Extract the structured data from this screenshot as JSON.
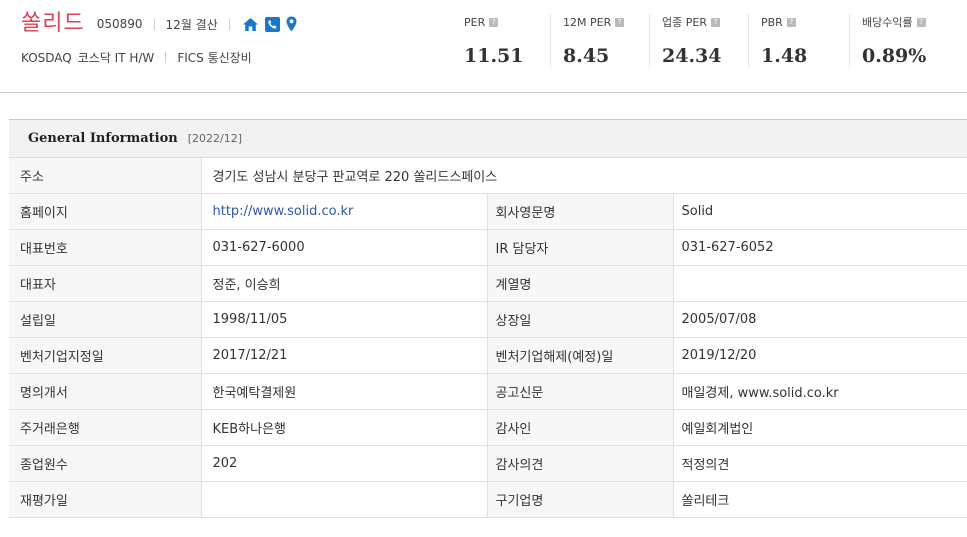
{
  "company": {
    "name": "쏠리드",
    "code": "050890",
    "settlement": "12월 결산",
    "market": "KOSDAQ",
    "sector": "코스닥 IT H/W",
    "fics": "FICS 통신장비"
  },
  "icons": [
    "home-icon",
    "phone-icon",
    "location-pin-icon",
    "help-icon"
  ],
  "colors": {
    "company_name": "#e23e56",
    "icon_blue": "#1a78c8",
    "link": "#2f58a8"
  },
  "metrics": [
    {
      "label": "PER",
      "value": "11.51"
    },
    {
      "label": "12M PER",
      "value": "8.45"
    },
    {
      "label": "업종 PER",
      "value": "24.34"
    },
    {
      "label": "PBR",
      "value": "1.48"
    },
    {
      "label": "배당수익률",
      "value": "0.89%"
    }
  ],
  "help_glyph": "?",
  "general": {
    "title": "General Information",
    "date": "[2022/12]",
    "address_label": "주소",
    "address_value": "경기도 성남시 분당구 판교역로 220 쏠리드스페이스",
    "rows": [
      {
        "l1": "홈페이지",
        "v1": "http://www.solid.co.kr",
        "l2": "회사영문명",
        "v2": "Solid"
      },
      {
        "l1": "대표번호",
        "v1": "031-627-6000",
        "l2": "IR 담당자",
        "v2": "031-627-6052"
      },
      {
        "l1": "대표자",
        "v1": "정준, 이승희",
        "l2": "계열명",
        "v2": ""
      },
      {
        "l1": "설립일",
        "v1": "1998/11/05",
        "l2": "상장일",
        "v2": "2005/07/08"
      },
      {
        "l1": "벤처기업지정일",
        "v1": "2017/12/21",
        "l2": "벤처기업해제(예정)일",
        "v2": "2019/12/20"
      },
      {
        "l1": "명의개서",
        "v1": "한국예탁결제원",
        "l2": "공고신문",
        "v2": "매일경제, www.solid.co.kr"
      },
      {
        "l1": "주거래은행",
        "v1": "KEB하나은행",
        "l2": "감사인",
        "v2": "예일회계법인"
      },
      {
        "l1": "종업원수",
        "v1": "202",
        "l2": "감사의견",
        "v2": "적정의견"
      },
      {
        "l1": "재평가일",
        "v1": "",
        "l2": "구기업명",
        "v2": "쏠리테크"
      }
    ]
  }
}
